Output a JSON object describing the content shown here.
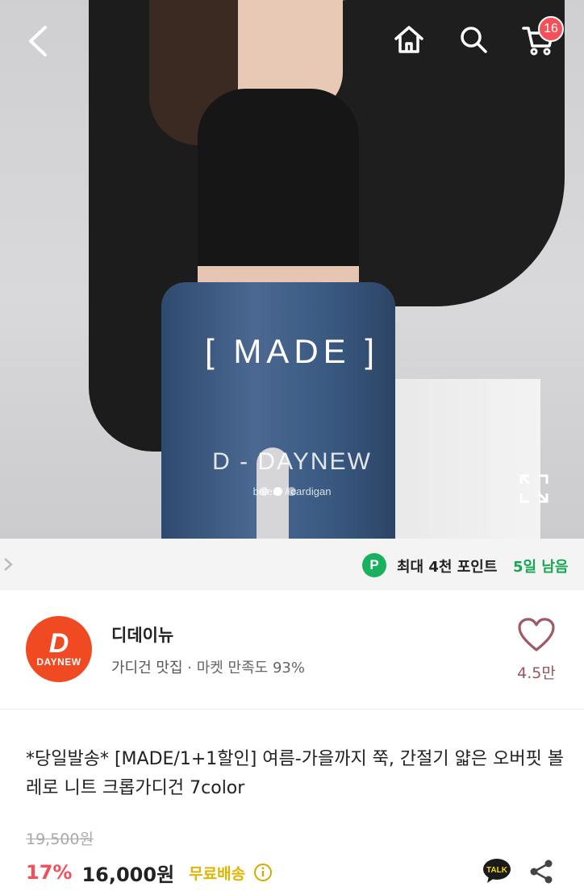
{
  "header": {
    "cart_count": "16",
    "icons": [
      "back-icon",
      "home-icon",
      "search-icon",
      "cart-icon"
    ]
  },
  "hero": {
    "title": "[ MADE ]",
    "brand": "D - DAYNEW",
    "subtitle": "bolero / cardigan",
    "slide_count": 3,
    "active_slide": 1
  },
  "points": {
    "badge": "P",
    "text": "최대 4천 포인트",
    "days_left": "5일 남음",
    "accent": "#19b15f"
  },
  "seller": {
    "logo_letter": "D",
    "logo_text": "DAYNEW",
    "name": "디데이뉴",
    "category": "가디건 맛집",
    "satisfaction": "· 마켓 만족도 93%",
    "likes": "4.5만",
    "brand_color": "#f04a22"
  },
  "product": {
    "title": "*당일발송* [MADE/1+1할인] 여름-가을까지 쭉, 간절기 얇은 오버핏 볼레로 니트 크롭가디건 7color",
    "original_price": "19,500원",
    "discount": "17%",
    "price": "16,000원",
    "shipping": "무료배송",
    "talk_label": "TALK",
    "discount_color": "#f2505a"
  }
}
